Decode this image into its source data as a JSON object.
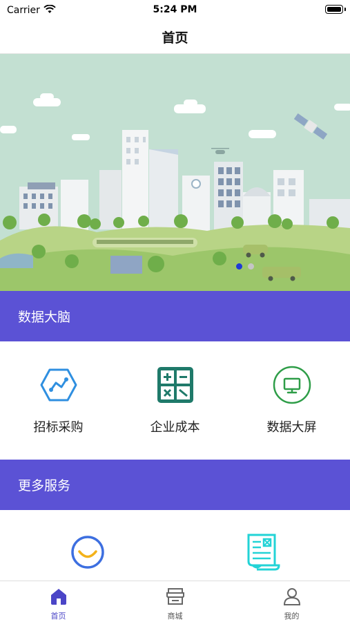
{
  "status_bar": {
    "carrier": "Carrier",
    "time": "5:24 PM"
  },
  "nav": {
    "title": "首页"
  },
  "banner": {
    "page_count": 2,
    "active_index": 0
  },
  "sections": {
    "data_brain": {
      "title": "数据大脑"
    },
    "more_services": {
      "title": "更多服务"
    }
  },
  "features": [
    {
      "label": "招标采购",
      "icon": "hexagon-chart-icon"
    },
    {
      "label": "企业成本",
      "icon": "calculator-icon"
    },
    {
      "label": "数据大屏",
      "icon": "monitor-icon"
    }
  ],
  "services": [
    {
      "icon": "smile-circle-icon"
    },
    {
      "icon": "document-scroll-icon"
    }
  ],
  "tabs": [
    {
      "label": "首页",
      "icon": "home-icon",
      "active": true
    },
    {
      "label": "商城",
      "icon": "store-icon",
      "active": false
    },
    {
      "label": "我的",
      "icon": "user-icon",
      "active": false
    }
  ],
  "colors": {
    "accent": "#5b52d5",
    "tab_active": "#4b45c7",
    "teal": "#1f7a6a",
    "green": "#2e9d48",
    "blue": "#2f8fe0"
  }
}
